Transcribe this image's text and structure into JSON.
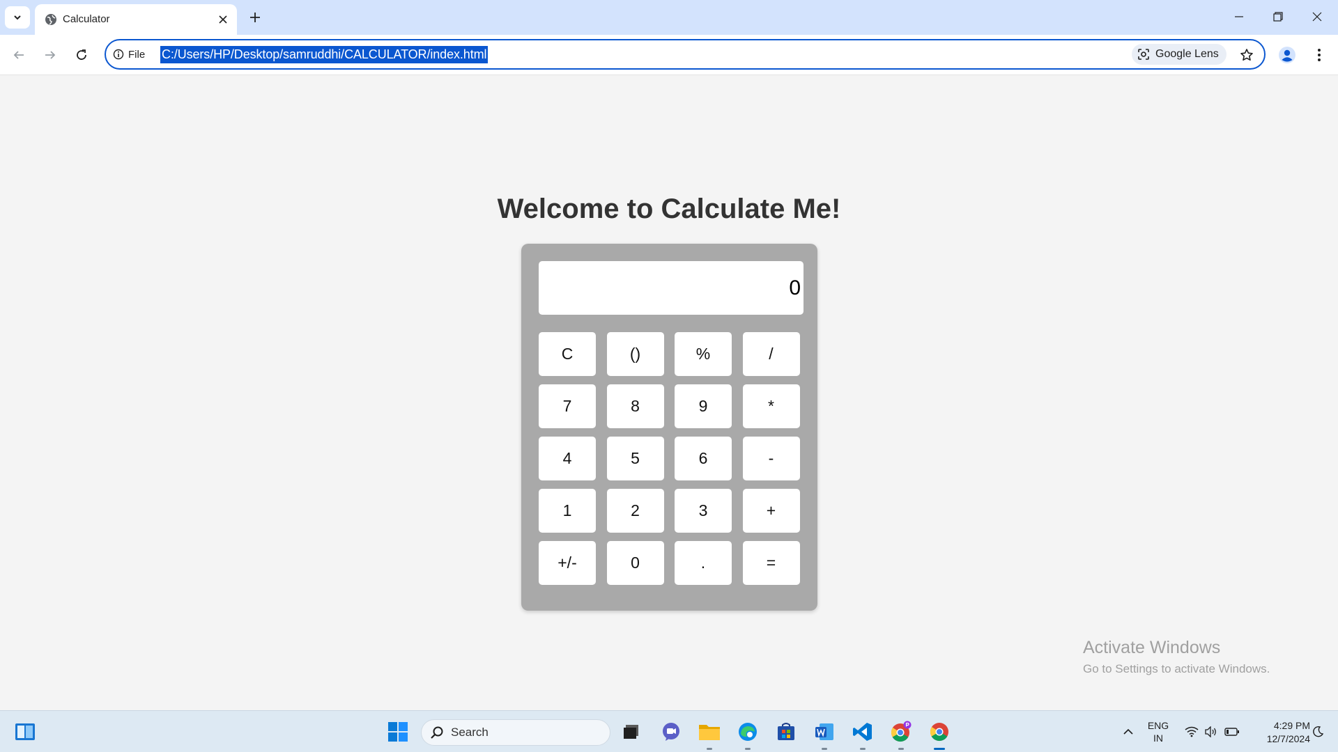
{
  "browser": {
    "tab_title": "Calculator",
    "site_info_label": "File",
    "url": "C:/Users/HP/Desktop/samruddhi/CALCULATOR/index.html",
    "lens_label": "Google Lens"
  },
  "page": {
    "title": "Welcome to Calculate Me!",
    "display_value": "0",
    "keys": [
      "C",
      "()",
      "%",
      "/",
      "7",
      "8",
      "9",
      "*",
      "4",
      "5",
      "6",
      "-",
      "1",
      "2",
      "3",
      "+",
      "+/-",
      "0",
      ".",
      "="
    ]
  },
  "watermark": {
    "title": "Activate Windows",
    "subtitle": "Go to Settings to activate Windows."
  },
  "taskbar": {
    "search_label": "Search",
    "lang_line1": "ENG",
    "lang_line2": "IN",
    "time": "4:29 PM",
    "date": "12/7/2024"
  },
  "colors": {
    "accent": "#0b57d0",
    "tabbar": "#d3e3fd",
    "calculator_body": "#a9a9a9",
    "page_background": "#f4f4f4"
  }
}
